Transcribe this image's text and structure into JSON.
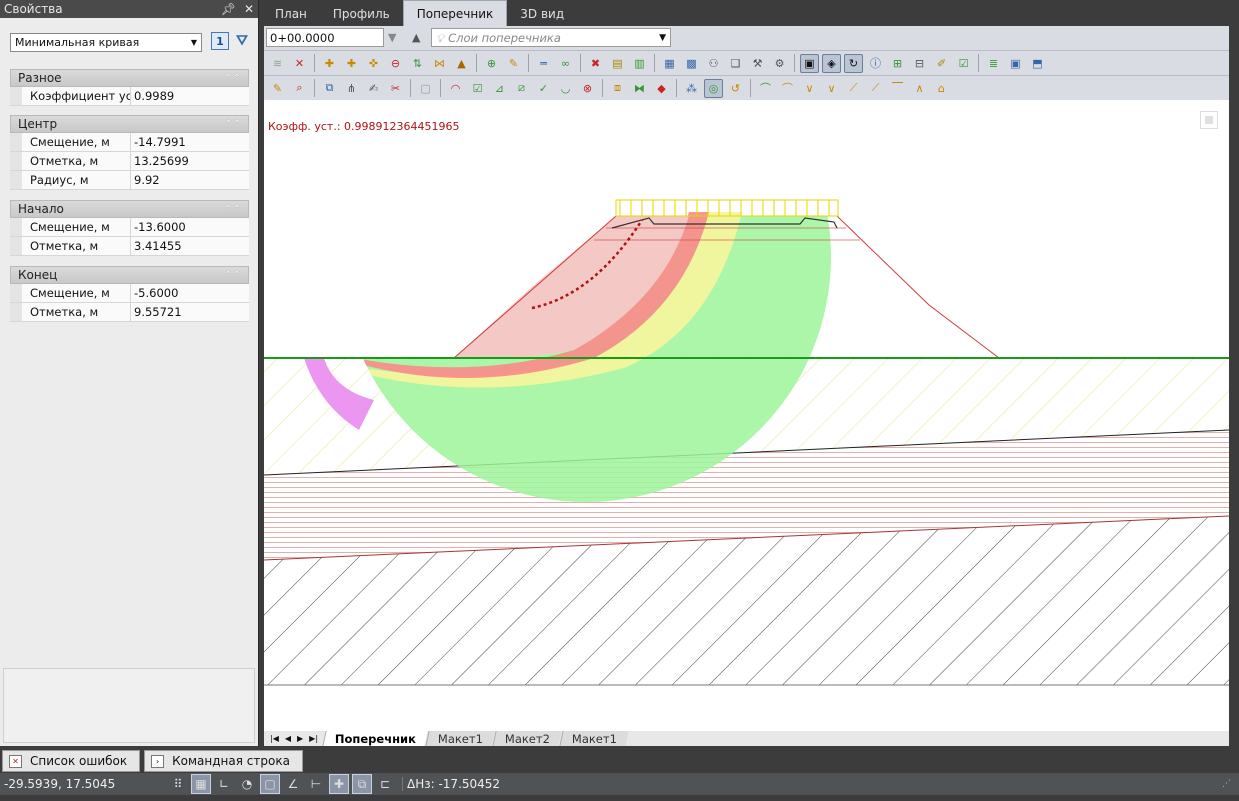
{
  "properties_panel": {
    "title": "Свойства",
    "pin_icon": "pin-icon",
    "close_icon": "close-icon",
    "selected_object": "Минимальная кривая",
    "sections": [
      {
        "title": "Разное",
        "rows": [
          {
            "key": "Коэффициент ус...",
            "value": "0.9989"
          }
        ]
      },
      {
        "title": "Центр",
        "rows": [
          {
            "key": "Смещение, м",
            "value": "-14.7991"
          },
          {
            "key": "Отметка, м",
            "value": "13.25699"
          },
          {
            "key": "Радиус, м",
            "value": "9.92"
          }
        ]
      },
      {
        "title": "Начало",
        "rows": [
          {
            "key": "Смещение, м",
            "value": "-13.6000"
          },
          {
            "key": "Отметка, м",
            "value": "3.41455"
          }
        ]
      },
      {
        "title": "Конец",
        "rows": [
          {
            "key": "Смещение, м",
            "value": "-5.6000"
          },
          {
            "key": "Отметка, м",
            "value": "9.55721"
          }
        ]
      }
    ]
  },
  "view_tabs": [
    {
      "label": "План",
      "active": false
    },
    {
      "label": "Профиль",
      "active": false
    },
    {
      "label": "Поперечник",
      "active": true
    },
    {
      "label": "3D вид",
      "active": false
    }
  ],
  "station_input": {
    "value": "0+00.0000"
  },
  "layers_dropdown": {
    "placeholder": "Слои поперечника"
  },
  "canvas": {
    "stability_label": "Коэфф. уст.: 0.998912364451965",
    "colors": {
      "slip_green": "#9ef59a",
      "slip_yellow": "#f2f59c",
      "slip_red": "#fb8a8a",
      "slip_pink": "#f8c6c6",
      "slip_magenta": "#e98cf0",
      "ground_line": "#1a9a1a",
      "embankment": "#d23a3a",
      "hatch_yellow": "#e7e58a",
      "hatch_red": "#e29a9a",
      "hatch_black": "#444444"
    }
  },
  "layout_tabs": [
    {
      "label": "Поперечник",
      "active": true
    },
    {
      "label": "Макет1",
      "active": false
    },
    {
      "label": "Макет2",
      "active": false
    },
    {
      "label": "Макет1",
      "active": false
    }
  ],
  "bottom_panels": [
    {
      "label": "Список ошибок",
      "icon": "error-list-icon"
    },
    {
      "label": "Командная строка",
      "icon": "command-line-icon"
    }
  ],
  "status_bar": {
    "coordinates": "-29.5939, 17.5045",
    "delta_h": "ΔHз: -17.50452"
  }
}
